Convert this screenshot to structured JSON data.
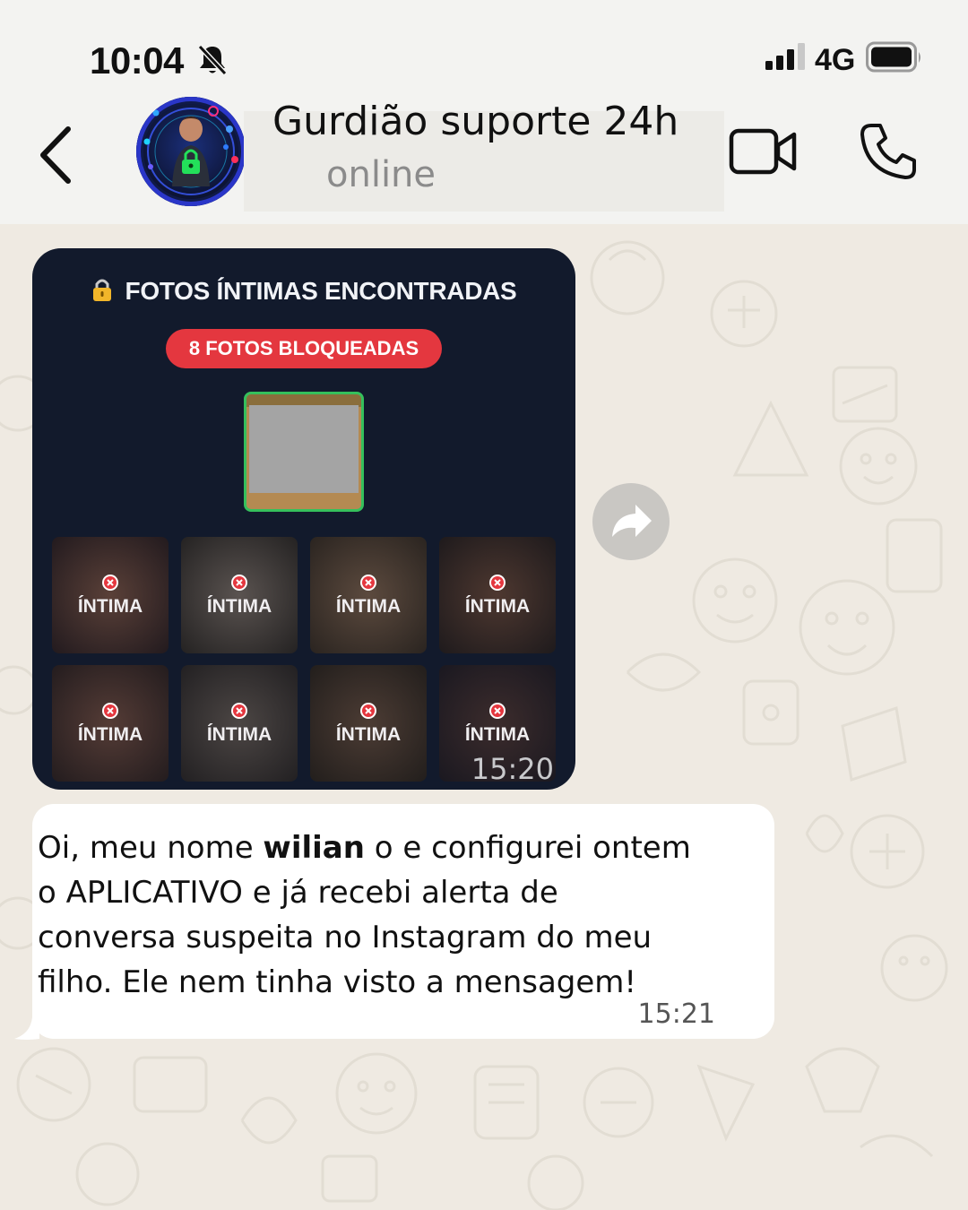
{
  "status_bar": {
    "time": "10:04",
    "network": "4G"
  },
  "header": {
    "contact_name": "Gurdião suporte 24h",
    "contact_status": "online"
  },
  "image_message": {
    "title": "FOTOS ÍNTIMAS ENCONTRADAS",
    "badge": "8 FOTOS BLOQUEADAS",
    "tiles": [
      "ÍNTIMA",
      "ÍNTIMA",
      "ÍNTIMA",
      "ÍNTIMA",
      "ÍNTIMA",
      "ÍNTIMA",
      "ÍNTIMA",
      "ÍNTIMA"
    ],
    "time": "15:20"
  },
  "text_message": {
    "line1_before": "Oi, meu nome ",
    "line1_bold": "wilian",
    "line1_after": " o e configurei ontem",
    "line2": "o APLICATIVO e já recebi alerta de",
    "line3": "conversa suspeita no Instagram do meu",
    "line4": "filho. Ele nem tinha visto a mensagem!",
    "time": "15:21"
  },
  "colors": {
    "chat_background": "#efeae2",
    "card_background": "#121a2c",
    "badge": "#e4373f",
    "preview_border": "#35c05c"
  }
}
